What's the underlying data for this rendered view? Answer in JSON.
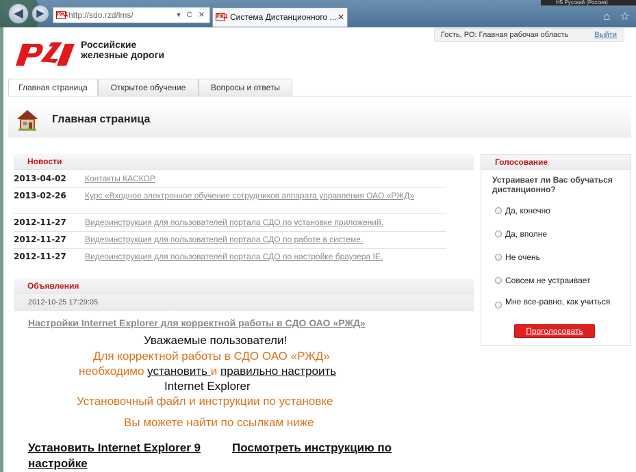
{
  "browser": {
    "address_url": "http://sdo.rzd/lms/",
    "tab_title": "Система Дистанционного ...",
    "tab_close": "✕",
    "back_glyph": "◀",
    "forward_glyph": "▶",
    "address_controls": "▾ C ✕",
    "favicon_text": "РЖД",
    "top_right_fragment": "Н5 Русский (Россия)",
    "top_icons": "⌂ ☆"
  },
  "userbar": {
    "text": "Гость, РО: Главная рабочая область",
    "logout": "Выйти"
  },
  "logo": {
    "line1": "Российские",
    "line2": "железные дороги",
    "brand_color": "#e2191c"
  },
  "menu": [
    {
      "label": "Главная страница",
      "active": true
    },
    {
      "label": "Открытое обучение",
      "active": false
    },
    {
      "label": "Вопросы и ответы",
      "active": false
    }
  ],
  "page_title": "Главная страница",
  "news": {
    "heading": "Новости",
    "items": [
      {
        "date": "2013-04-02",
        "text": "Контакты КАСКОР"
      },
      {
        "date": "2013-02-26",
        "text": "Курс «Входное электронное обучение сотрудников аппарата управления ОАО «РЖД»"
      },
      {
        "date": "2012-11-27",
        "text": "Видеоинструкция для пользователей портала СДО по установке приложений."
      },
      {
        "date": "2012-11-27",
        "text": "Видеоинструкция для пользователей портала СДО по работе в системе."
      },
      {
        "date": "2012-11-27",
        "text": "Видеоинструкция для пользователей портала СДО по настройке браузера IE."
      }
    ]
  },
  "announcements": {
    "heading": "Объявления",
    "date": "2012-10-25 17:29:05",
    "title": "Настройки Internet Explorer для корректной работы в СДО ОАО «РЖД»",
    "greeting": "Уважаемые пользователи!",
    "line1": "Для корректной работы в СДО ОАО «РЖД»",
    "line2_prefix": "необходимо ",
    "line2_link1": "установить ",
    "line2_mid": " и ",
    "line2_link2": "правильно настроить",
    "line3": "Internet Explorer",
    "line4": "Установочный файл и инструкции по установке",
    "line5": "Вы можете найти по ссылкам ниже",
    "link_install": "Установить Internet Explorer 9",
    "link_instr_1": "Посмотреть инструкцию по",
    "link_instr_2": "настройке"
  },
  "poll": {
    "heading": "Голосование",
    "question": "Устраивает ли Вас обучаться дистанционно?",
    "options": [
      "Да, конечно",
      "Да, вполне",
      "Не очень",
      "Совсем не устраивает",
      "Мне все-равно, как учиться"
    ],
    "vote_button": "Проголосовать"
  }
}
